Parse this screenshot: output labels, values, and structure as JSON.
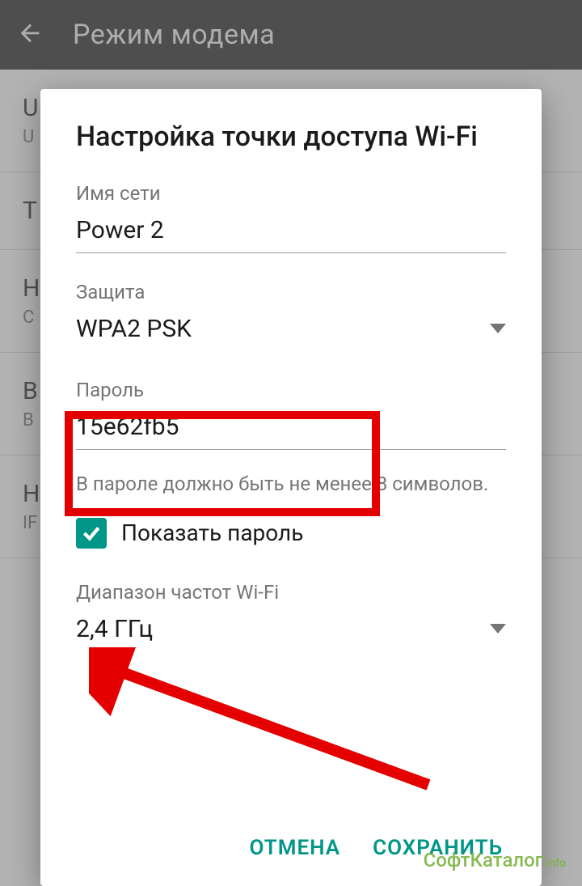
{
  "header": {
    "title": "Режим модема"
  },
  "background_rows": [
    {
      "primary": "U",
      "secondary": "U"
    },
    {
      "primary": "Т",
      "secondary": ""
    },
    {
      "primary": "Н",
      "secondary": "С"
    },
    {
      "primary": "B",
      "secondary": "B"
    },
    {
      "primary": "Н",
      "secondary": "IF"
    }
  ],
  "dialog": {
    "title": "Настройка точки доступа Wi-Fi",
    "network_label": "Имя сети",
    "network_value": "Power 2",
    "security_label": "Защита",
    "security_value": "WPA2 PSK",
    "password_label": "Пароль",
    "password_value": "15e62fb5",
    "password_helper": "В пароле должно быть не менее 8 символов.",
    "show_password_label": "Показать пароль",
    "band_label": "Диапазон частот Wi-Fi",
    "band_value": "2,4 ГГц",
    "cancel": "ОТМЕНА",
    "save": "СОХРАНИТЬ"
  },
  "watermark": {
    "text": "СофтКаталог",
    "suffix": ".info"
  },
  "colors": {
    "accent": "#009688",
    "annotation": "#e40000"
  }
}
